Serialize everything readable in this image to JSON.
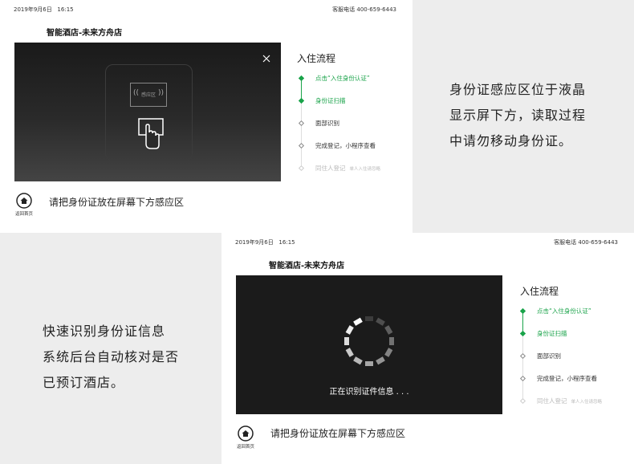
{
  "panel1": {
    "status": {
      "date": "2019年9月6日",
      "time": "16:15",
      "hotline": "客服电话 400-659-6443"
    },
    "hotel_name": "智能酒店-未来方舟店",
    "sensor_label": "感应区",
    "flow_title": "入住流程",
    "steps": [
      {
        "label": "点击“入住身份认证”",
        "state": "active"
      },
      {
        "label": "身份证扫描",
        "state": "active"
      },
      {
        "label": "面部识别",
        "state": "pending"
      },
      {
        "label": "完成登记，小程序查看",
        "state": "pending"
      },
      {
        "label": "同住人登记",
        "sub": "单人入住请忽略",
        "state": "disabled"
      }
    ],
    "home_label": "返回首页",
    "instruction": "请把身份证放在屏幕下方感应区"
  },
  "caption1": [
    "身份证感应区位于液晶",
    "显示屏下方，读取过程",
    "中请勿移动身份证。"
  ],
  "panel2": {
    "status": {
      "date": "2019年9月6日",
      "time": "16:15",
      "hotline": "客服电话 400-659-6443"
    },
    "hotel_name": "智能酒店-未来方舟店",
    "loading_text": "正在识别证件信息 . . .",
    "flow_title": "入住流程",
    "steps": [
      {
        "label": "点击“入住身份认证”",
        "state": "active"
      },
      {
        "label": "身份证扫描",
        "state": "active"
      },
      {
        "label": "面部识别",
        "state": "pending"
      },
      {
        "label": "完成登记，小程序查看",
        "state": "pending"
      },
      {
        "label": "同住人登记",
        "sub": "单人入住请忽略",
        "state": "disabled"
      }
    ],
    "home_label": "返回首页",
    "instruction": "请把身份证放在屏幕下方感应区"
  },
  "caption2": [
    "快速识别身份证信息",
    "系统后台自动核对是否",
    "已预订酒店。"
  ],
  "colors": {
    "accent": "#1aa34a",
    "video_bg": "#1b1b1b"
  },
  "icons": [
    "close-icon",
    "hand-card-icon",
    "home-icon",
    "loading-spinner-icon"
  ]
}
